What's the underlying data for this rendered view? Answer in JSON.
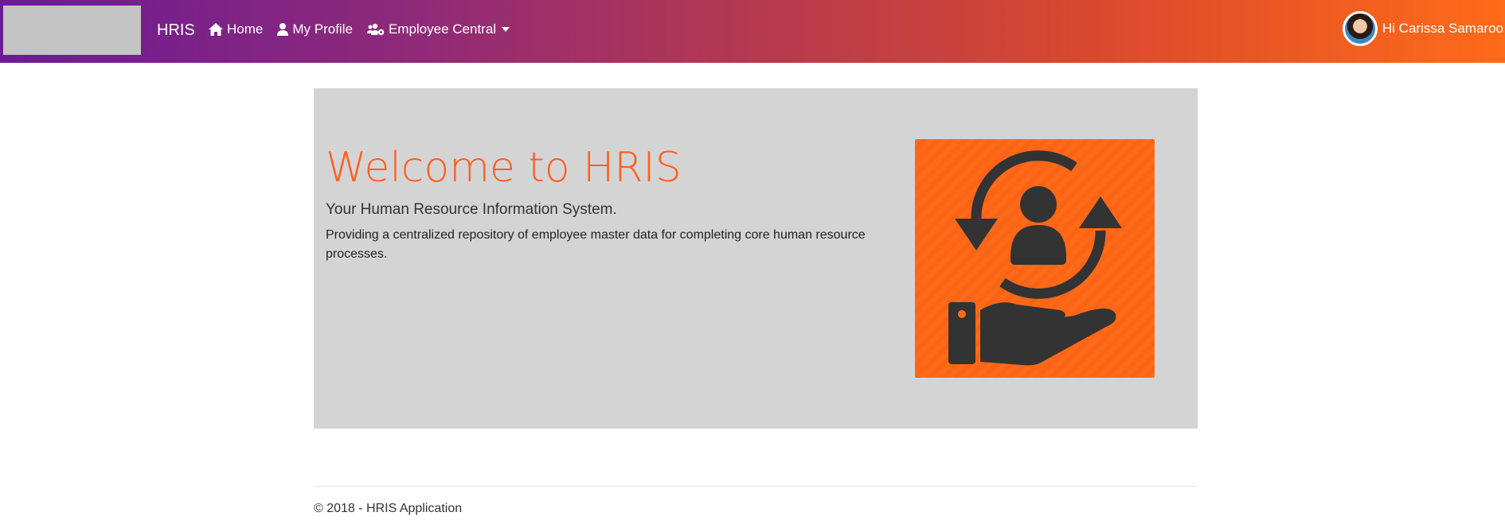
{
  "nav": {
    "brand": "HRIS",
    "items": [
      {
        "label": "Home",
        "icon": "home-icon"
      },
      {
        "label": "My Profile",
        "icon": "user-icon"
      },
      {
        "label": "Employee Central",
        "icon": "users-cog-icon"
      }
    ],
    "user_greeting": "Hi Carissa Samaroo"
  },
  "hero": {
    "title": "Welcome to HRIS",
    "subtitle": "Your Human Resource Information System.",
    "description": "Providing a centralized repository of employee master data for completing core human resource processes.",
    "image_icon": "employee-care-icon"
  },
  "footer": {
    "text": "© 2018 - HRIS Application"
  },
  "colors": {
    "accent": "#ff5f1f",
    "nav_start": "#6a1b95",
    "nav_end": "#ff6b18",
    "jumbotron_bg": "#d5d4d5"
  }
}
